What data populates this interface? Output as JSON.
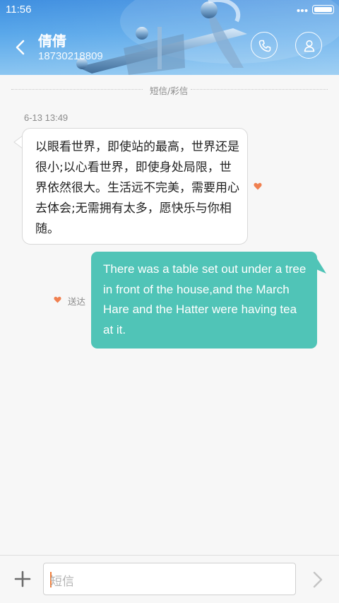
{
  "status_bar": {
    "time": "11:56",
    "icons": [
      "more-dots-icon",
      "battery-icon"
    ]
  },
  "header": {
    "contact_name": "倩倩",
    "contact_number": "18730218809",
    "icons": [
      "back-arrow-icon",
      "phone-icon",
      "person-icon"
    ],
    "colors": {
      "header_gradient_top": "#3f8fe0",
      "header_gradient_bottom": "#8cc6f1"
    }
  },
  "conversation": {
    "divider_label": "短信/彩信",
    "timestamp": "6-13 13:49",
    "incoming": {
      "text": "以眼看世界，即使站的最高，世界还是很小;以心看世界，即使身处局限，世界依然很大。生活远不完美，需要用心去体会;无需拥有太多，愿快乐与你相随。",
      "status_icon": "heart-icon"
    },
    "outgoing": {
      "text": "There was a table set out under a tree in front of the house,and the March Hare and the Hatter were having tea at it.",
      "status_icon": "heart-icon",
      "status_label": "送达"
    },
    "colors": {
      "outgoing_bubble": "#50c4b7",
      "incoming_bubble": "#ffffff",
      "heart": "#f08050"
    }
  },
  "composer": {
    "placeholder": "短信",
    "icons": [
      "plus-icon",
      "send-chevron-icon"
    ],
    "colors": {
      "caret": "#ef7d3a"
    }
  }
}
